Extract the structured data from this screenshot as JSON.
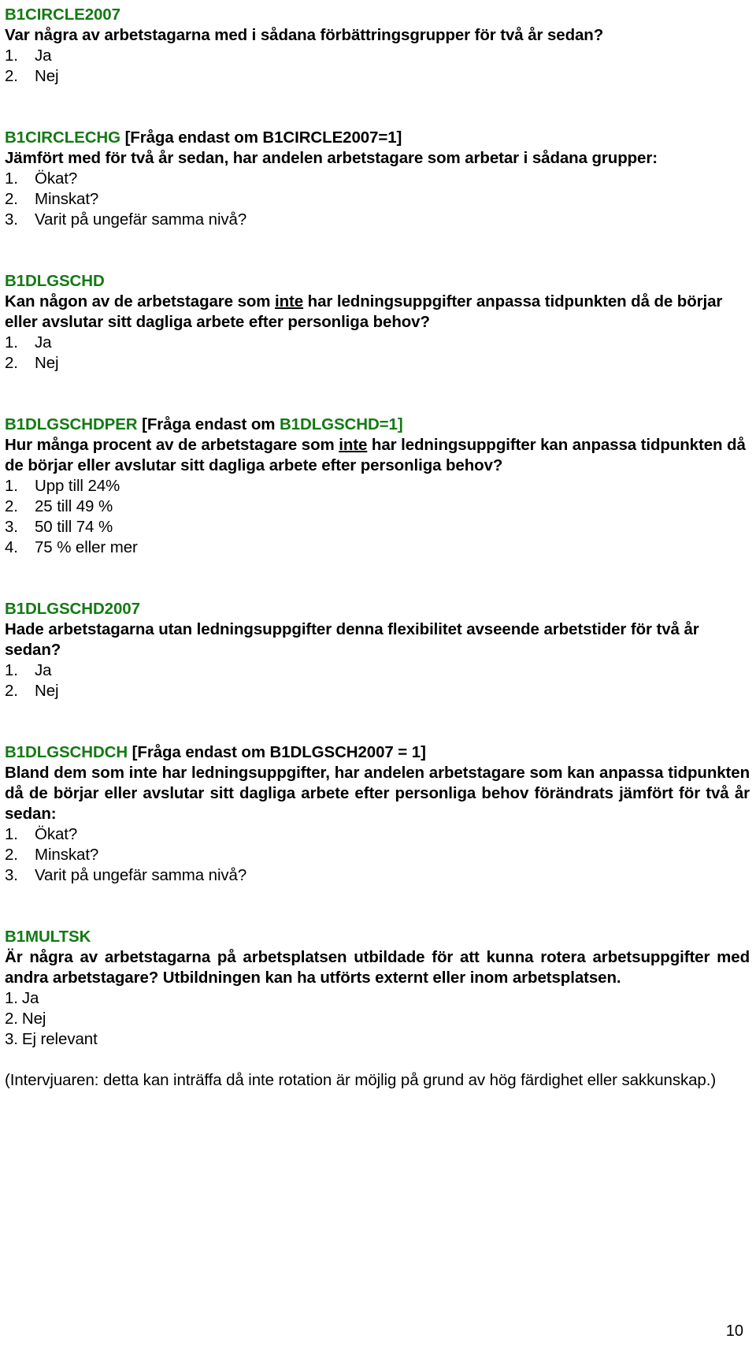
{
  "document": {
    "page_number": "10",
    "accent_color": "#137a13",
    "text_color": "#000000"
  },
  "blocks": [
    {
      "code": "B1CIRCLE2007",
      "condition": "",
      "question": "Var några av arbetstagarna med i sådana förbättringsgrupper för två år sedan?",
      "options": [
        {
          "num": "1.",
          "label": "Ja"
        },
        {
          "num": "2.",
          "label": "Nej"
        }
      ]
    },
    {
      "code": "B1CIRCLECHG",
      "condition": " [Fråga endast om B1CIRCLE2007=1]",
      "question": "Jämfört med för två år sedan, har andelen arbetstagare som arbetar i sådana grupper:",
      "options": [
        {
          "num": "1.",
          "label": "Ökat?"
        },
        {
          "num": "2.",
          "label": "Minskat?"
        },
        {
          "num": "3.",
          "label": "Varit på ungefär samma nivå?"
        }
      ]
    },
    {
      "code": "B1DLGSCHD",
      "condition": "",
      "question_part1": "Kan någon av de arbetstagare som ",
      "question_underline": "inte",
      "question_part2": " har ledningsuppgifter anpassa tidpunkten då de börjar eller avslutar sitt dagliga arbete efter personliga behov?",
      "options": [
        {
          "num": "1.",
          "label": "Ja"
        },
        {
          "num": "2.",
          "label": "Nej"
        }
      ]
    },
    {
      "code": "B1DLGSCHDPER",
      "condition_pre": " [Fråga endast om ",
      "condition_code": "B1DLGSCHD=1]",
      "question_part1": "Hur många procent av de arbetstagare som ",
      "question_underline": "inte",
      "question_part2": " har ledningsuppgifter kan anpassa tidpunkten då de börjar eller avslutar sitt dagliga arbete efter personliga behov?",
      "options": [
        {
          "num": "1.",
          "label": "Upp till 24%"
        },
        {
          "num": "2.",
          "label": "25 till 49 %"
        },
        {
          "num": "3.",
          "label": "50 till 74 %"
        },
        {
          "num": "4.",
          "label": "75 % eller mer"
        }
      ]
    },
    {
      "code": "B1DLGSCHD2007",
      "condition": "",
      "question": "Hade arbetstagarna utan ledningsuppgifter denna flexibilitet avseende arbetstider för två år sedan?",
      "options": [
        {
          "num": "1.",
          "label": "Ja"
        },
        {
          "num": "2.",
          "label": "Nej"
        }
      ]
    },
    {
      "code": "B1DLGSCHDCH",
      "condition": " [Fråga endast om B1DLGSCH2007 = 1]",
      "question": "Bland dem som inte har ledningsuppgifter, har andelen arbetstagare som kan anpassa tidpunkten då de börjar eller avslutar sitt dagliga arbete efter personliga behov förändrats jämfört för två år sedan:",
      "options": [
        {
          "num": "1.",
          "label": "Ökat?"
        },
        {
          "num": "2.",
          "label": "Minskat?"
        },
        {
          "num": "3.",
          "label": "Varit på ungefär samma nivå?"
        }
      ]
    },
    {
      "code": "B1MULTSK",
      "condition": "",
      "question": "Är några av arbetstagarna på arbetsplatsen utbildade för att kunna rotera arbetsuppgifter med andra arbetstagare? Utbildningen kan ha utförts externt eller inom arbetsplatsen.",
      "options": [
        {
          "num": "1.",
          "label": "Ja"
        },
        {
          "num": "2.",
          "label": "Nej"
        },
        {
          "num": "3.",
          "label": "Ej relevant"
        }
      ],
      "note": "(Intervjuaren: detta kan inträffa då inte rotation är möjlig på grund av hög färdighet eller sakkunskap.)"
    }
  ]
}
